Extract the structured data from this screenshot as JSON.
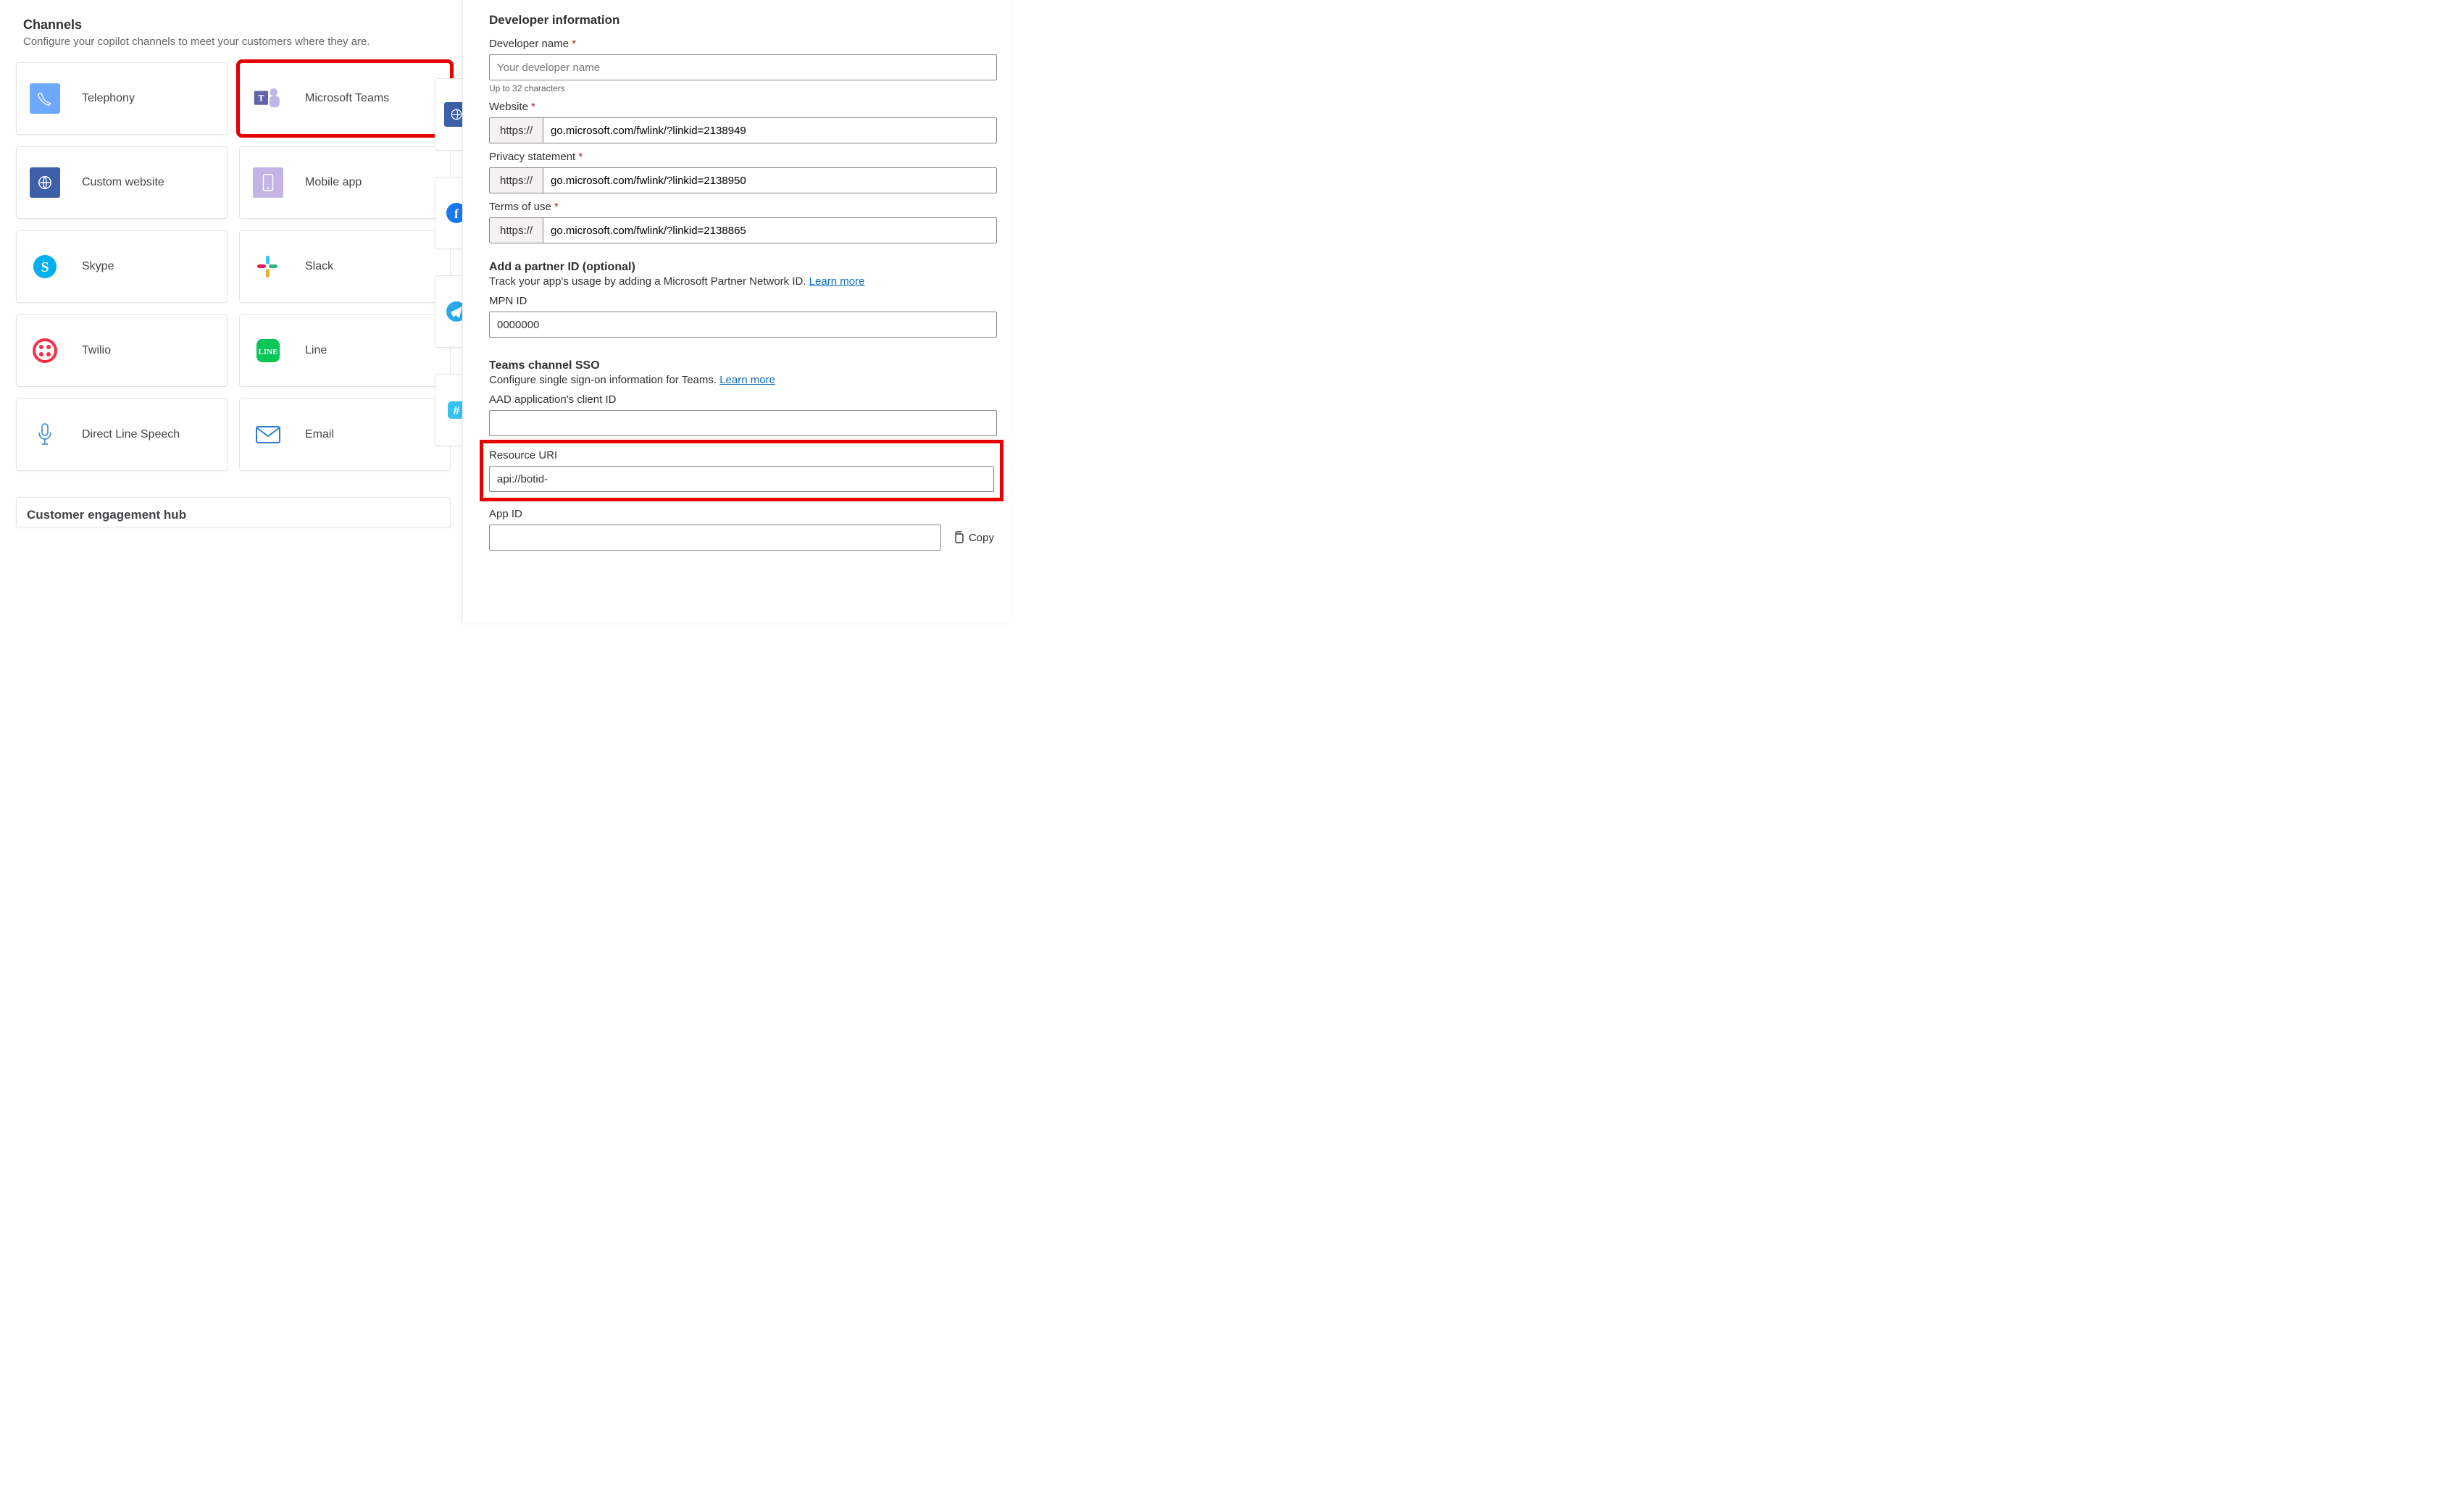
{
  "left": {
    "title": "Channels",
    "subtitle": "Configure your copilot channels to meet your customers where they are.",
    "tiles": {
      "telephony": "Telephony",
      "ms_teams": "Microsoft Teams",
      "custom_web": "Custom website",
      "mobile_app": "Mobile app",
      "skype": "Skype",
      "slack": "Slack",
      "twilio": "Twilio",
      "line": "Line",
      "dls": "Direct Line Speech",
      "email": "Email"
    },
    "ceh_title": "Customer engagement hub"
  },
  "right": {
    "dev_info_title": "Developer information",
    "dev_name_label": "Developer name",
    "dev_name_placeholder": "Your developer name",
    "dev_name_hint": "Up to 32 characters",
    "website_label": "Website",
    "privacy_label": "Privacy statement",
    "terms_label": "Terms of use",
    "https_prefix": "https://",
    "website_val": "go.microsoft.com/fwlink/?linkid=2138949",
    "privacy_val": "go.microsoft.com/fwlink/?linkid=2138950",
    "terms_val": "go.microsoft.com/fwlink/?linkid=2138865",
    "partner_title": "Add a partner ID (optional)",
    "partner_desc": "Track your app's usage by adding a Microsoft Partner Network ID. ",
    "learn_more": "Learn more",
    "mpn_label": "MPN ID",
    "mpn_val": "0000000",
    "sso_title": "Teams channel SSO",
    "sso_desc": "Configure single sign-on information for Teams. ",
    "aad_label": "AAD application's client ID",
    "resource_label": "Resource URI",
    "resource_val": "api://botid-",
    "appid_label": "App ID",
    "copy_label": "Copy"
  }
}
